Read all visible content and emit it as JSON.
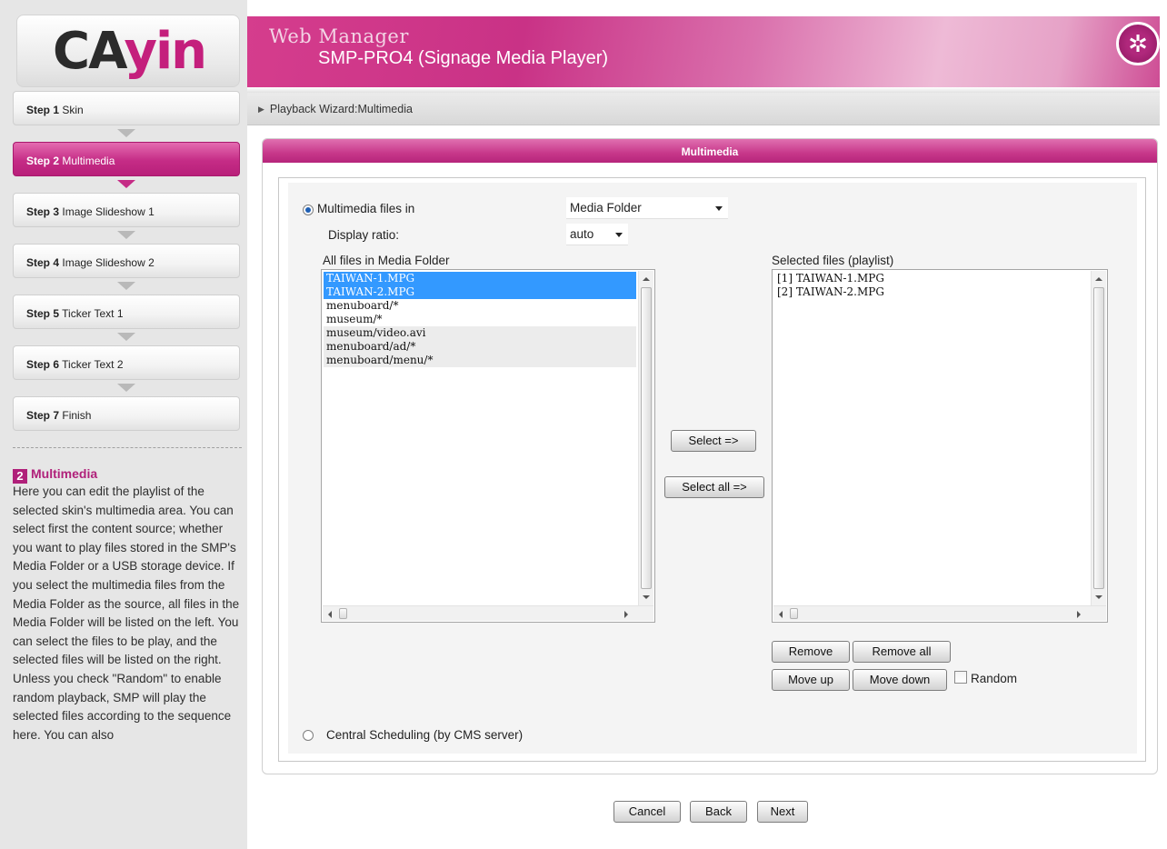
{
  "brand": {
    "logo_part1": "CA",
    "logo_part2": "yin"
  },
  "header": {
    "app_title": "Web Manager",
    "product": "SMP-PRO4 (Signage Media Player)",
    "logo_icon": "cayin-emblem-icon"
  },
  "steps": [
    {
      "num": "Step 1",
      "label": "Skin"
    },
    {
      "num": "Step 2",
      "label": "Multimedia"
    },
    {
      "num": "Step 3",
      "label": "Image Slideshow 1"
    },
    {
      "num": "Step 4",
      "label": "Image Slideshow 2"
    },
    {
      "num": "Step 5",
      "label": "Ticker Text 1"
    },
    {
      "num": "Step 6",
      "label": "Ticker Text 2"
    },
    {
      "num": "Step 7",
      "label": "Finish"
    }
  ],
  "active_step": 2,
  "help": {
    "number": "2",
    "title": "Multimedia",
    "body": "Here you can edit the playlist of the selected skin's multimedia area. You can select first the content source; whether you want to play files stored in the SMP's Media Folder or a USB storage device. If you select the multimedia files from the Media Folder as the source, all files in the Media Folder will be listed on the left. You can select the files to be play, and the selected files will be listed on the right. Unless you check \"Random\" to enable random playback, SMP will play the selected files according to the sequence here. You can also"
  },
  "breadcrumb": "Playback Wizard:Multimedia",
  "panel": {
    "title": "Multimedia",
    "source_option_label": "Multimedia files in",
    "source_select_value": "Media Folder",
    "ratio_label": "Display ratio:",
    "ratio_select_value": "auto",
    "all_files_label": "All files in Media Folder",
    "selected_files_label": "Selected files (playlist)",
    "all_files": [
      {
        "name": "TAIWAN-1.MPG",
        "selected": true
      },
      {
        "name": "TAIWAN-2.MPG",
        "selected": true
      },
      {
        "name": "menuboard/*",
        "selected": false
      },
      {
        "name": "museum/*",
        "selected": false
      },
      {
        "name": "museum/video.avi",
        "selected": false
      },
      {
        "name": "menuboard/ad/*",
        "selected": false
      },
      {
        "name": "menuboard/menu/*",
        "selected": false
      }
    ],
    "playlist": [
      "[1] TAIWAN-1.MPG",
      "[2] TAIWAN-2.MPG"
    ],
    "select_button": "Select =>",
    "select_all_button": "Select all =>",
    "remove_button": "Remove",
    "remove_all_button": "Remove all",
    "move_up_button": "Move up",
    "move_down_button": "Move down",
    "random_label": "Random",
    "central_option_label": "Central Scheduling (by CMS server)"
  },
  "footer": {
    "cancel": "Cancel",
    "back": "Back",
    "next": "Next"
  },
  "colors": {
    "accent": "#c52c86",
    "selection": "#3399ff"
  }
}
